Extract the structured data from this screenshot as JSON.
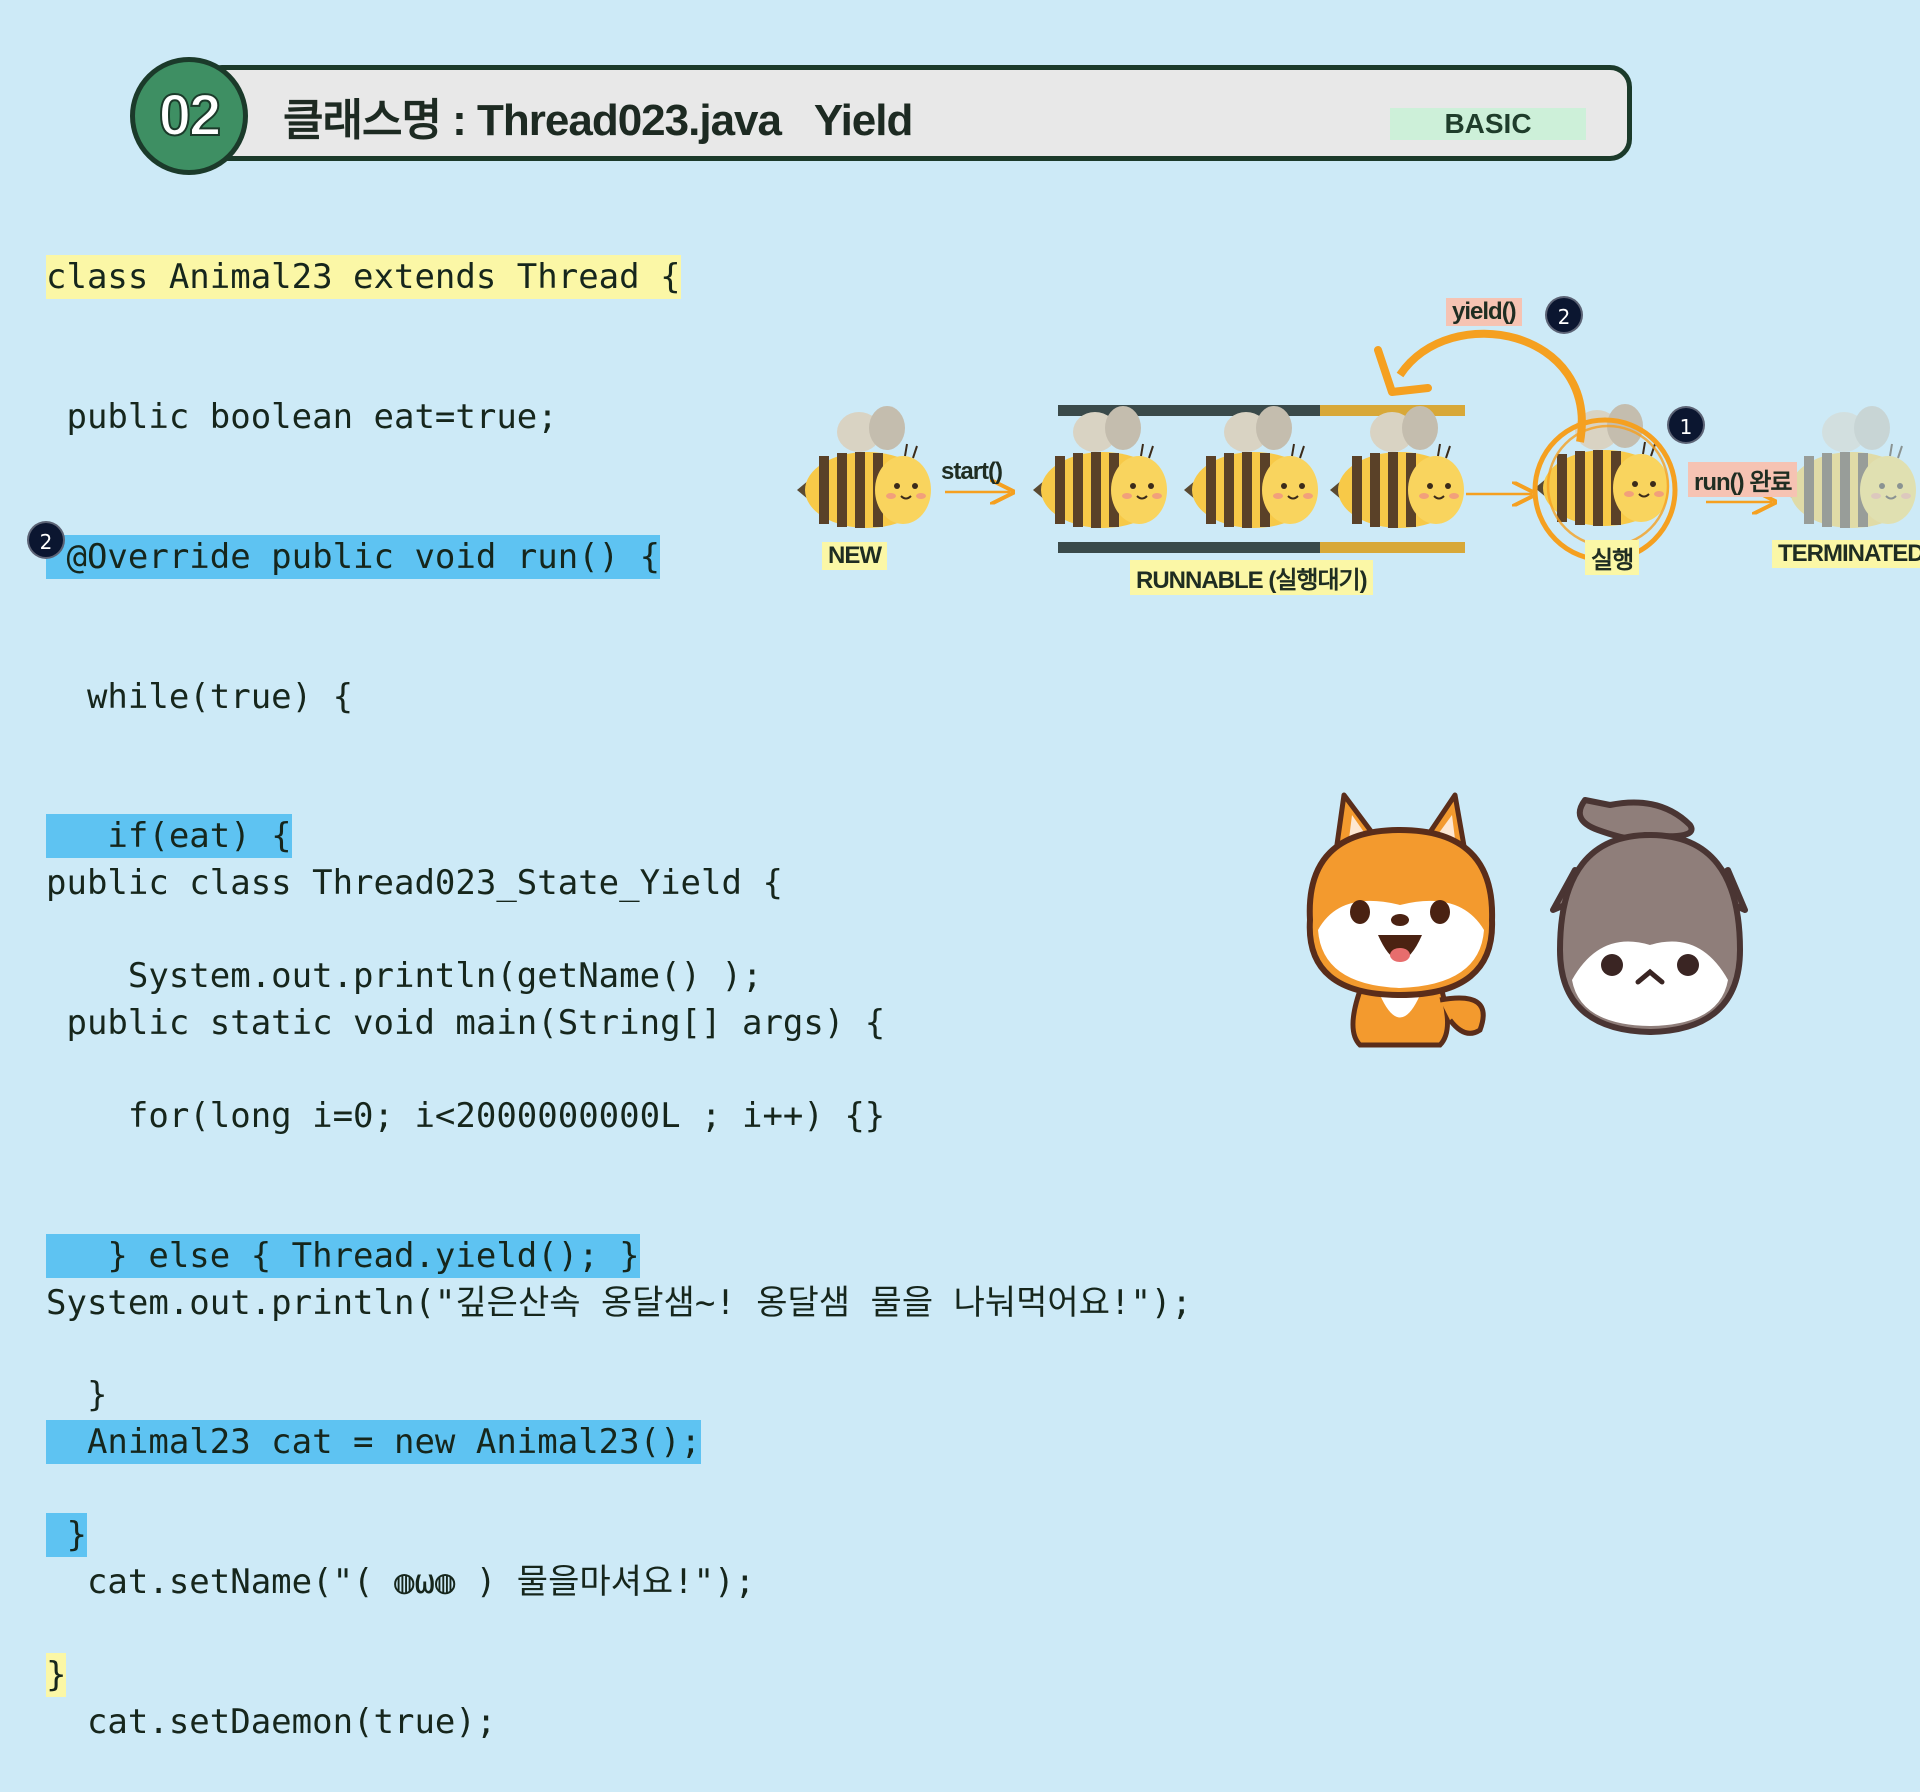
{
  "header": {
    "number": "02",
    "title": "클래스명 : Thread023.java   Yield",
    "badge": "BASIC"
  },
  "code_top": [
    "class Animal23 extends Thread {",
    " public boolean eat=true;",
    " @Override public void run() {",
    "  while(true) {",
    "   if(eat) {",
    "    System.out.println(getName() );",
    "    for(long i=0; i<2000000000L ; i++) {}",
    "   } else { Thread.yield(); }",
    "  }",
    " }",
    "}"
  ],
  "code_bottom": [
    "public class Thread023_State_Yield {",
    " public static void main(String[] args) {",
    "",
    "System.out.println(\"깊은산속 옹달샘~! 옹달샘 물을 나눠먹어요!\");",
    "  Animal23 cat = new Animal23();",
    "  cat.setName(\"( ◍ω◍ ) 물을마셔요!\");",
    "  cat.setDaemon(true);"
  ],
  "markers": {
    "code_marker": "2",
    "yield_marker": "2",
    "run_marker": "1"
  },
  "diagram": {
    "new_label": "NEW",
    "start_label": "start()",
    "runnable_label": "RUNNABLE (실행대기)",
    "running_label": "실행",
    "yield_label": "yield()",
    "run_done_label": "run() 완료",
    "terminated_label": "TERMINATED"
  },
  "colors": {
    "background": "#cdeaf7",
    "header_green": "#3e8f63",
    "highlight_yellow": "#fbf7a6",
    "highlight_blue": "#5ec3f2",
    "arrow_orange": "#f5a020"
  }
}
